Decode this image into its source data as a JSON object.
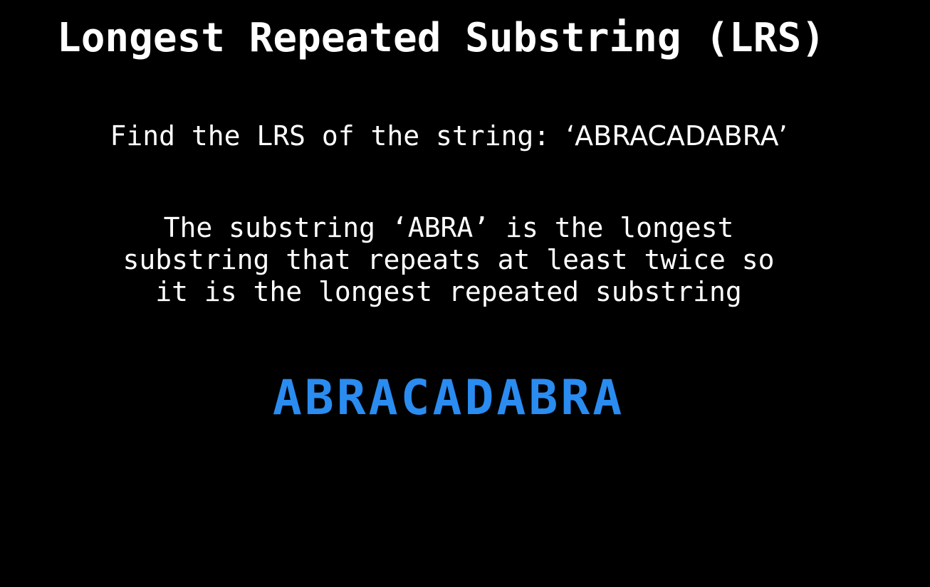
{
  "title": "Longest Repeated Substring (LRS)",
  "prompt": {
    "text": "Find the LRS of the string: ",
    "quoted": "‘ABRACADABRA’"
  },
  "explanation": {
    "lines": [
      "The substring ‘ABRA’ is the longest",
      "substring that repeats at least twice so",
      "it is the longest repeated substring"
    ]
  },
  "highlight": {
    "text": "ABRACADABRA",
    "color": "#2a8cf0"
  },
  "colors": {
    "background": "#000000",
    "text": "#ffffff"
  }
}
